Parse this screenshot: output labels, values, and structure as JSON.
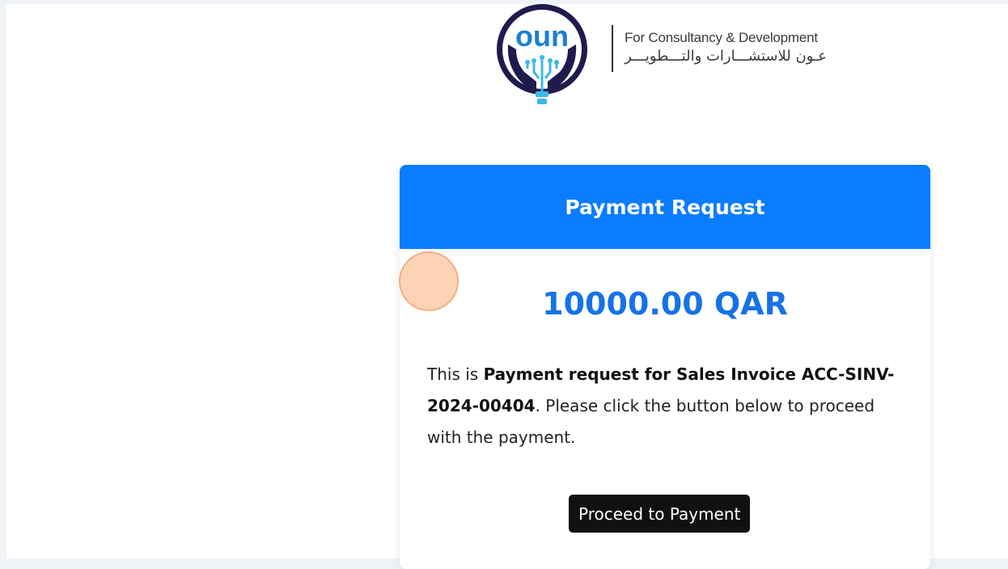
{
  "logo": {
    "mark_text": "oun",
    "tagline_en": "For Consultancy & Development",
    "tagline_ar": "عـون للاستشـــارات والتـــطويـــر",
    "brand_navy": "#1f1b4d",
    "brand_cyan": "#3db8e8"
  },
  "card": {
    "title": "Payment Request",
    "amount": "10000.00 QAR",
    "message_prefix": "This is ",
    "message_bold": "Payment request for Sales Invoice ACC-SINV-2024-00404",
    "message_suffix": ". Please click the button below to proceed with the payment.",
    "button_label": "Proceed to Payment",
    "header_color": "#0a7cff",
    "amount_color": "#1672e6"
  }
}
